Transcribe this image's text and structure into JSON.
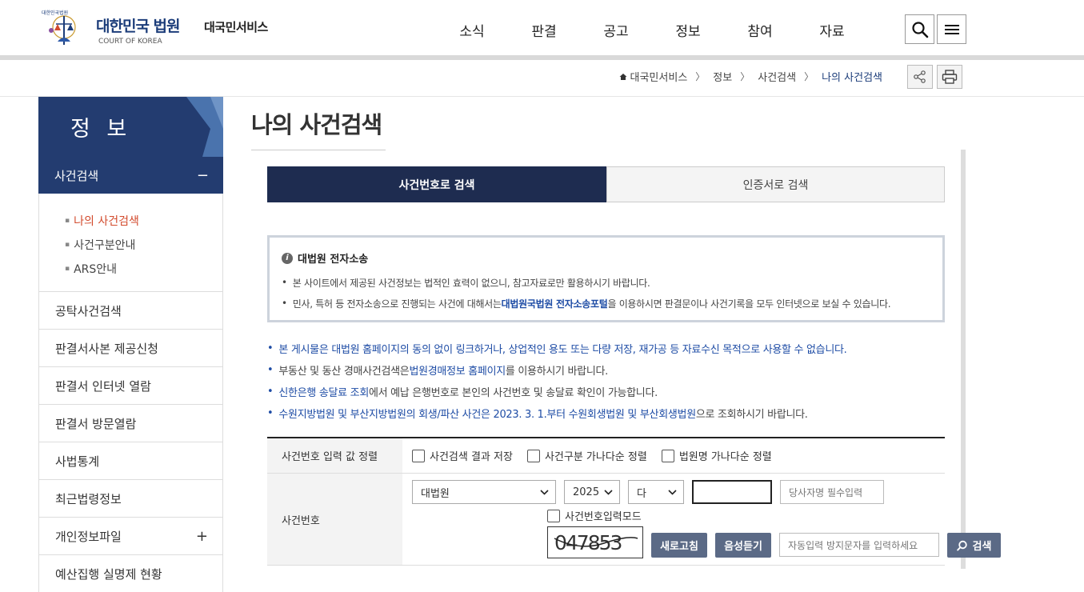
{
  "header": {
    "emblem_text": "대한민국법원",
    "logo_title": "대한민국 법원",
    "logo_subtitle": "COURT OF KOREA",
    "site_name": "대국민서비스",
    "nav": [
      "소식",
      "판결",
      "공고",
      "정보",
      "참여",
      "자료"
    ],
    "search_icon": "search-icon",
    "menu_icon": "hamburger-menu-icon"
  },
  "breadcrumb": {
    "home": "대국민서비스",
    "items": [
      "정보",
      "사건검색"
    ],
    "current": "나의 사건검색",
    "share_icon": "share-icon",
    "print_icon": "print-icon"
  },
  "sidebar": {
    "title": "정 보",
    "open_item": "사건검색",
    "open_toggle": "−",
    "sub_items": [
      "나의 사건검색",
      "사건구분안내",
      "ARS안내"
    ],
    "items": [
      {
        "label": "공탁사건검색",
        "toggle": ""
      },
      {
        "label": "판결서사본 제공신청",
        "toggle": ""
      },
      {
        "label": "판결서 인터넷 열람",
        "toggle": ""
      },
      {
        "label": "판결서 방문열람",
        "toggle": ""
      },
      {
        "label": "사법통계",
        "toggle": ""
      },
      {
        "label": "최근법령정보",
        "toggle": ""
      },
      {
        "label": "개인정보파일",
        "toggle": "+"
      },
      {
        "label": "예산집행 실명제 현황",
        "toggle": ""
      }
    ]
  },
  "main": {
    "title": "나의 사건검색",
    "tabs": [
      "사건번호로 검색",
      "인증서로 검색"
    ],
    "notice": {
      "title": "대법원 전자소송",
      "line1": "본 사이트에서 제공된 사건정보는 법적인 효력이 없으니, 참고자료로만 활용하시기 바랍니다.",
      "line2_prefix": "민사, 특허 등 전자소송으로 진행되는 사건에 대해서는 ",
      "line2_link": "대법원국법원 전자소송포털",
      "line2_suffix": "을 이용하시면 판결문이나 사건기록을 모두 인터넷으로 보실 수 있습니다."
    },
    "bullets": {
      "b1": "본 게시물은 대법원 홈페이지의 동의 없이 링크하거나, 상업적인 용도 또는 다량 저장, 재가공 등 자료수신 목적으로 사용할 수 없습니다.",
      "b2_prefix": "부동산 및 동산 경매사건검색은 ",
      "b2_link": "법원경매정보 홈페이지",
      "b2_suffix": "를 이용하시기 바랍니다.",
      "b3_link": "신한은행 송달료 조회",
      "b3_suffix": "에서 예납 은행번호로 본인의 사건번호 및 송달료 확인이 가능합니다.",
      "b4_prefix": "수원지방법원 및 부산지방법원의 회생/파산 사건은 2023. 3. 1.부터 수원회생법원 및 부산회생법원",
      "b4_suffix": "으로 조회하시기 바랍니다."
    },
    "form": {
      "sort_label": "사건번호 입력 값 정렬",
      "sort_options": [
        "사건검색 결과 저장",
        "사건구분 가나다순 정렬",
        "법원명 가나다순 정렬"
      ],
      "case_label": "사건번호",
      "court_value": "대법원",
      "year_value": "2025",
      "type_value": "다",
      "serial_value": "",
      "party_placeholder": "당사자명 필수입력",
      "input_mode_label": "사건번호입력모드",
      "captcha_text": "047853",
      "refresh_button": "새로고침",
      "audio_button": "음성듣기",
      "captcha_placeholder": "자동입력 방지문자를 입력하세요",
      "search_button": "검색"
    }
  },
  "colors": {
    "navy": "#233c70",
    "tab_active": "#1e2c50",
    "link_blue": "#1e4ca5",
    "active_red": "#d24a2c",
    "button_gray_blue": "#5b6a86"
  }
}
